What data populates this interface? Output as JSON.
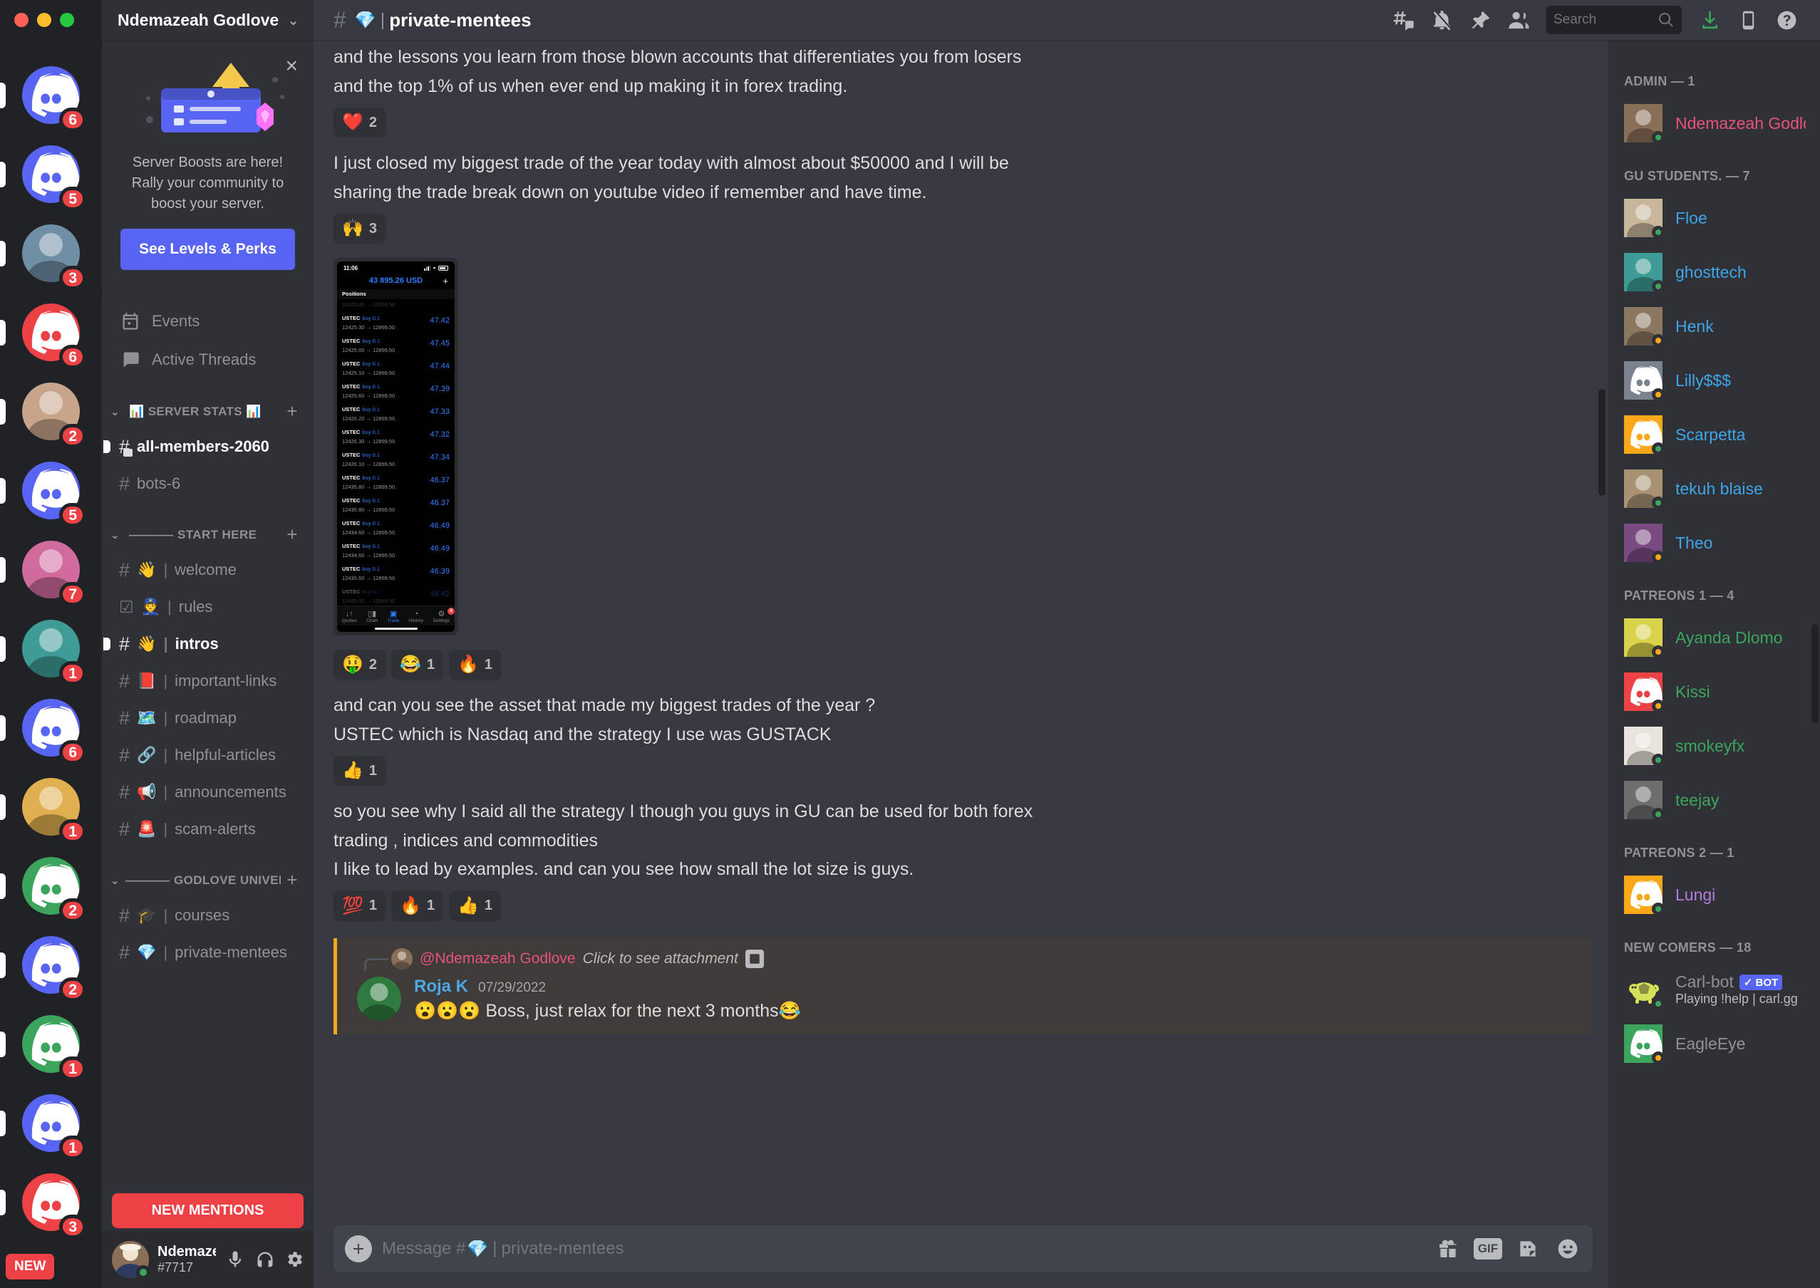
{
  "window": {
    "traffic_lights": [
      "close",
      "minimize",
      "maximize"
    ]
  },
  "server_rail": {
    "items": [
      {
        "name": "discord-server-1",
        "kind": "discord",
        "color": "#5865f2",
        "badge": "6"
      },
      {
        "name": "discord-server-2",
        "kind": "discord",
        "color": "#5865f2",
        "badge": "5"
      },
      {
        "name": "photo-server-3",
        "kind": "photo",
        "color": "#6f8fa5",
        "badge": "3"
      },
      {
        "name": "discord-server-4",
        "kind": "discord",
        "color": "#ed4245",
        "badge": "6"
      },
      {
        "name": "photo-server-5",
        "kind": "photo",
        "color": "#c7a58a",
        "badge": "2"
      },
      {
        "name": "discord-server-6",
        "kind": "discord",
        "color": "#5865f2",
        "badge": "5"
      },
      {
        "name": "photo-server-7",
        "kind": "photo",
        "color": "#d16b9e",
        "badge": "7"
      },
      {
        "name": "jerry-server-8",
        "kind": "photo",
        "color": "#3e9c96",
        "badge": "1"
      },
      {
        "name": "discord-server-9",
        "kind": "discord",
        "color": "#5865f2",
        "badge": "6"
      },
      {
        "name": "photo-server-10",
        "kind": "photo",
        "color": "#e0b050",
        "badge": "1"
      },
      {
        "name": "discord-server-11",
        "kind": "discord",
        "color": "#3ba55d",
        "badge": "2"
      },
      {
        "name": "discord-server-12",
        "kind": "discord",
        "color": "#5865f2",
        "badge": "2"
      },
      {
        "name": "discord-server-13",
        "kind": "discord",
        "color": "#3ba55d",
        "badge": "1"
      },
      {
        "name": "discord-server-14",
        "kind": "discord",
        "color": "#5865f2",
        "badge": "1"
      },
      {
        "name": "discord-server-15",
        "kind": "discord",
        "color": "#ed4245",
        "badge": "3"
      }
    ],
    "new_label": "NEW"
  },
  "sidebar": {
    "server_name": "Ndemazeah Godlove",
    "boost": {
      "text": "Server Boosts are here! Rally your community to boost your server.",
      "button": "See Levels & Perks",
      "close_label": "×"
    },
    "nav": [
      {
        "name": "events",
        "label": "Events",
        "icon": "calendar-icon"
      },
      {
        "name": "active-threads",
        "label": "Active Threads",
        "icon": "threads-icon"
      }
    ],
    "categories": [
      {
        "name": "server-stats",
        "label": "📊 SERVER STATS 📊",
        "label_text": "SERVER STATS",
        "emoji_left": "📊",
        "emoji_right": "📊",
        "divider": false,
        "channels": [
          {
            "name": "all-members-2060",
            "emoji": "",
            "label": "all-members-2060",
            "unread": true,
            "kind": "announcement"
          },
          {
            "name": "bots-6",
            "emoji": "",
            "label": "bots-6",
            "unread": false,
            "kind": "text"
          }
        ]
      },
      {
        "name": "start-here",
        "label_text": "START HERE",
        "divider": true,
        "channels": [
          {
            "name": "welcome",
            "emoji": "👋",
            "label": "welcome",
            "unread": false,
            "kind": "text"
          },
          {
            "name": "rules",
            "emoji": "👮",
            "label": "rules",
            "unread": false,
            "kind": "rules"
          },
          {
            "name": "intros",
            "emoji": "👋",
            "label": "intros",
            "unread": true,
            "kind": "text"
          },
          {
            "name": "important-links",
            "emoji": "📕",
            "label": "important-links",
            "unread": false,
            "kind": "text"
          },
          {
            "name": "roadmap",
            "emoji": "🗺️",
            "label": "roadmap",
            "unread": false,
            "kind": "text"
          },
          {
            "name": "helpful-articles",
            "emoji": "🔗",
            "label": "helpful-articles",
            "unread": false,
            "kind": "text"
          },
          {
            "name": "announcements",
            "emoji": "📢",
            "label": "announcements",
            "unread": false,
            "kind": "text"
          },
          {
            "name": "scam-alerts",
            "emoji": "🚨",
            "label": "scam-alerts",
            "unread": false,
            "kind": "text"
          }
        ]
      },
      {
        "name": "godlove-university",
        "label_text": "GODLOVE UNIVERSITY...",
        "divider": true,
        "channels": [
          {
            "name": "courses",
            "emoji": "🎓",
            "label": "courses",
            "unread": false,
            "kind": "text"
          },
          {
            "name": "private-mentees",
            "emoji": "💎",
            "label": "private-mentees",
            "unread": false,
            "kind": "text"
          }
        ]
      }
    ],
    "new_mentions": "NEW MENTIONS",
    "user": {
      "name": "Ndemazeah...",
      "tag": "#7717",
      "status": "online"
    },
    "user_controls": [
      {
        "name": "mic-button",
        "icon": "microphone-icon"
      },
      {
        "name": "headphones-button",
        "icon": "headphones-icon"
      },
      {
        "name": "user-settings-button",
        "icon": "gear-icon"
      }
    ]
  },
  "header": {
    "hash": "#",
    "emoji": "💎",
    "separator": "|",
    "channel_name": "private-mentees",
    "icons": [
      {
        "name": "threads-icon",
        "title": "Threads"
      },
      {
        "name": "notification-off-icon",
        "title": "Notification Settings"
      },
      {
        "name": "pin-icon",
        "title": "Pinned Messages"
      },
      {
        "name": "members-icon",
        "title": "Member List"
      }
    ],
    "search": {
      "placeholder": "Search",
      "value": ""
    },
    "right_icons": [
      {
        "name": "inbox-download-icon",
        "title": "Inbox",
        "color": "#3ba55d"
      },
      {
        "name": "mobile-icon",
        "title": "Mobile"
      },
      {
        "name": "help-icon",
        "title": "Help"
      }
    ]
  },
  "chat": {
    "messages": [
      {
        "name": "message-blown-accounts",
        "lines": [
          "and the lessons you learn from those blown accounts that differentiates you from losers",
          "and the top 1% of us when ever end up making it in forex trading."
        ],
        "reactions": [
          {
            "emoji": "❤️",
            "count": "2"
          }
        ]
      },
      {
        "name": "message-biggest-trade",
        "lines": [
          "I just closed my biggest trade of the year today with almost about $50000 and I will be",
          "sharing the trade break down on youtube video if remember and have time."
        ],
        "reactions": [
          {
            "emoji": "🙌",
            "count": "3"
          }
        ],
        "attachment": "trading-screenshot"
      },
      {
        "name": "message-asset-question",
        "lines": [
          "and can you see the asset that made my biggest trades of the year ?",
          "USTEC which is Nasdaq and the strategy I use was GUSTACK"
        ],
        "reactions": [
          {
            "emoji": "👍",
            "count": "1"
          }
        ]
      },
      {
        "name": "message-strategy-explainer",
        "lines": [
          "so you see why I said all the strategy I though you guys in GU can be used for both forex",
          "trading , indices and commodities",
          "I like to lead by examples. and can you see how small the lot size is guys."
        ],
        "reactions": [
          {
            "emoji": "💯",
            "count": "1"
          },
          {
            "emoji": "🔥",
            "count": "1"
          },
          {
            "emoji": "👍",
            "count": "1"
          }
        ]
      }
    ],
    "screenshot_reactions": [
      {
        "emoji": "🤑",
        "count": "2"
      },
      {
        "emoji": "😂",
        "count": "1"
      },
      {
        "emoji": "🔥",
        "count": "1"
      }
    ],
    "reply_message": {
      "name": "reply-message-roja-k",
      "reference": {
        "author": "@Ndemazeah Godlove",
        "text": "Click to see attachment",
        "attachment_icon": "image-icon"
      },
      "author": "Roja K",
      "timestamp": "07/29/2022",
      "text": "😮😮😮 Boss, just relax for the next 3 months😂"
    },
    "composer": {
      "placeholder_prefix": "Message #",
      "placeholder_emoji": "💎",
      "placeholder_sep": "|",
      "placeholder_channel": "private-mentees",
      "value": "",
      "buttons": [
        {
          "name": "attach-button",
          "icon": "plus-icon"
        },
        {
          "name": "gift-button",
          "icon": "gift-icon"
        },
        {
          "name": "gif-button",
          "icon": "gif-icon",
          "label": "GIF"
        },
        {
          "name": "sticker-button",
          "icon": "sticker-icon"
        },
        {
          "name": "emoji-button",
          "icon": "emoji-icon"
        }
      ]
    }
  },
  "trading_screenshot": {
    "time": "11:06",
    "balance": "43 895.26 USD",
    "positions_label": "Positions",
    "add_label": "+",
    "rows": [
      {
        "symbol": "",
        "side": "",
        "prices": "12426.00 → 12899.50",
        "value": "",
        "cut": true
      },
      {
        "symbol": "USTEC",
        "side": "buy 0.1",
        "prices": "12425.30 → 12899.50",
        "value": "47.42"
      },
      {
        "symbol": "USTEC",
        "side": "buy 0.1",
        "prices": "12425.00 → 12899.50",
        "value": "47.45"
      },
      {
        "symbol": "USTEC",
        "side": "buy 0.1",
        "prices": "12425.10 → 12899.50",
        "value": "47.44"
      },
      {
        "symbol": "USTEC",
        "side": "buy 0.1",
        "prices": "12425.60 → 12899.50",
        "value": "47.39"
      },
      {
        "symbol": "USTEC",
        "side": "buy 0.1",
        "prices": "12426.20 → 12899.50",
        "value": "47.33"
      },
      {
        "symbol": "USTEC",
        "side": "buy 0.1",
        "prices": "12426.30 → 12899.50",
        "value": "47.32"
      },
      {
        "symbol": "USTEC",
        "side": "buy 0.1",
        "prices": "12426.10 → 12899.50",
        "value": "47.34"
      },
      {
        "symbol": "USTEC",
        "side": "buy 0.1",
        "prices": "12435.80 → 12899.50",
        "value": "46.37"
      },
      {
        "symbol": "USTEC",
        "side": "buy 0.1",
        "prices": "12435.80 → 12899.50",
        "value": "46.37"
      },
      {
        "symbol": "USTEC",
        "side": "buy 0.1",
        "prices": "12434.60 → 12899.50",
        "value": "46.49"
      },
      {
        "symbol": "USTEC",
        "side": "buy 0.1",
        "prices": "12434.60 → 12899.50",
        "value": "46.49"
      },
      {
        "symbol": "USTEC",
        "side": "buy 0.1",
        "prices": "12435.60 → 12899.50",
        "value": "46.39"
      },
      {
        "symbol": "USTEC",
        "side": "buy 0.1",
        "prices": "12435.00 → 12899.50",
        "value": "46.42",
        "cut": true
      }
    ],
    "tabs": [
      {
        "name": "quotes-tab",
        "label": "Quotes",
        "icon": "↓↑",
        "active": false,
        "badge": ""
      },
      {
        "name": "chart-tab",
        "label": "Chart",
        "icon": "▯▮",
        "active": false,
        "badge": ""
      },
      {
        "name": "trade-tab",
        "label": "Trade",
        "icon": "▣",
        "active": true,
        "badge": ""
      },
      {
        "name": "history-tab",
        "label": "History",
        "icon": "◔",
        "active": false,
        "badge": ""
      },
      {
        "name": "settings-tab",
        "label": "Settings",
        "icon": "⚙",
        "active": false,
        "badge": "6"
      }
    ]
  },
  "members": {
    "groups": [
      {
        "name": "admin",
        "header": "ADMIN — 1",
        "items": [
          {
            "name": "Ndemazeah Godlove",
            "color": "#e8537a",
            "status": "online",
            "avatar_kind": "photo",
            "avatar_color": "#8a6f58",
            "sub": "",
            "bot": false
          }
        ]
      },
      {
        "name": "gu-students",
        "header": "GU STUDENTS. — 7",
        "items": [
          {
            "name": "Floe",
            "color": "#3ea6e8",
            "status": "online",
            "avatar_kind": "photo",
            "avatar_color": "#c9b79c",
            "sub": "",
            "bot": false
          },
          {
            "name": "ghosttech",
            "color": "#3ea6e8",
            "status": "online",
            "avatar_kind": "photo",
            "avatar_color": "#3e9c96",
            "sub": "",
            "bot": false
          },
          {
            "name": "Henk",
            "color": "#3ea6e8",
            "status": "idle",
            "avatar_kind": "photo",
            "avatar_color": "#8b7760",
            "sub": "",
            "bot": false
          },
          {
            "name": "Lilly$$$",
            "color": "#3ea6e8",
            "status": "idle",
            "avatar_kind": "discord",
            "avatar_color": "#7a8290",
            "sub": "",
            "bot": false
          },
          {
            "name": "Scarpetta",
            "color": "#3ea6e8",
            "status": "online",
            "avatar_kind": "discord",
            "avatar_color": "#faa81a",
            "sub": "",
            "bot": false
          },
          {
            "name": "tekuh blaise",
            "color": "#3ea6e8",
            "status": "online",
            "avatar_kind": "photo",
            "avatar_color": "#a89274",
            "sub": "",
            "bot": false
          },
          {
            "name": "Theo",
            "color": "#3ea6e8",
            "status": "idle",
            "avatar_kind": "photo",
            "avatar_color": "#7a4a82",
            "sub": "",
            "bot": false
          }
        ]
      },
      {
        "name": "patreons-1",
        "header": "PATREONS 1 — 4",
        "items": [
          {
            "name": "Ayanda Dlomo",
            "color": "#3ba55d",
            "status": "idle",
            "avatar_kind": "photo",
            "avatar_color": "#d8d34a",
            "sub": "",
            "bot": false
          },
          {
            "name": "Kissi",
            "color": "#3ba55d",
            "status": "idle",
            "avatar_kind": "discord",
            "avatar_color": "#ed4245",
            "sub": "",
            "bot": false
          },
          {
            "name": "smokeyfx",
            "color": "#3ba55d",
            "status": "online",
            "avatar_kind": "photo",
            "avatar_color": "#e8e4dc",
            "sub": "",
            "bot": false
          },
          {
            "name": "teejay",
            "color": "#3ba55d",
            "status": "online",
            "avatar_kind": "photo",
            "avatar_color": "#6e6e6e",
            "sub": "",
            "bot": false
          }
        ]
      },
      {
        "name": "patreons-2",
        "header": "PATREONS 2 — 1",
        "items": [
          {
            "name": "Lungi",
            "color": "#b57ae0",
            "status": "online",
            "avatar_kind": "discord",
            "avatar_color": "#faa81a",
            "sub": "",
            "bot": false
          }
        ]
      },
      {
        "name": "new-comers",
        "header": "NEW COMERS — 18",
        "items": [
          {
            "name": "Carl-bot",
            "color": "#8e9297",
            "status": "online",
            "avatar_kind": "turtle",
            "avatar_color": "#d7e05a",
            "sub": "Playing !help | carl.gg",
            "bot": true,
            "bot_label": "BOT"
          },
          {
            "name": "EagleEye",
            "color": "#8e9297",
            "status": "idle",
            "avatar_kind": "discord",
            "avatar_color": "#3ba55d",
            "sub": "",
            "bot": false
          }
        ]
      }
    ]
  }
}
